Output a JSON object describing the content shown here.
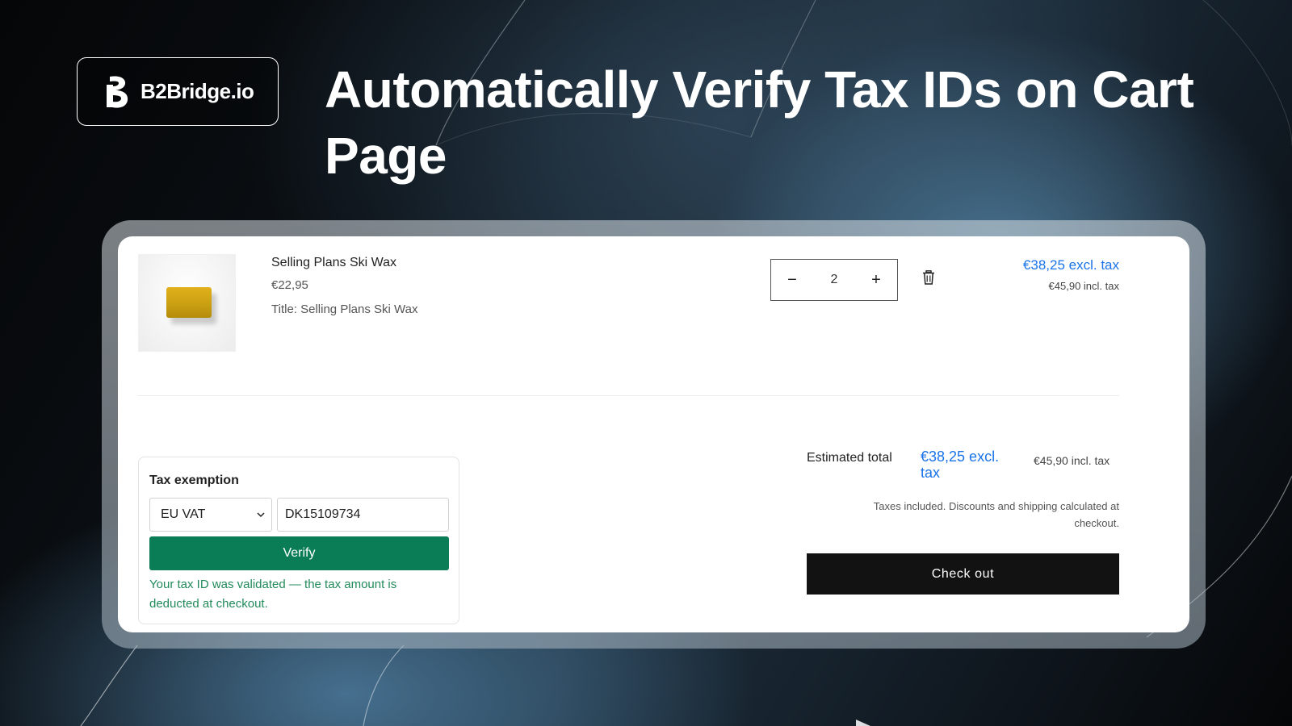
{
  "brand": {
    "name": "B2Bridge.io",
    "logo_icon": "b2bridge-logo-icon"
  },
  "headline": "Automatically Verify Tax IDs on Cart Page",
  "cart_item": {
    "image_icon": "ski-wax-product-image",
    "title": "Selling Plans Ski Wax",
    "unit_price": "€22,95",
    "variant": "Title: Selling Plans Ski Wax",
    "quantity": "2",
    "decrease_symbol": "−",
    "increase_symbol": "+",
    "remove_icon": "trash-icon",
    "price_excl_tax": "€38,25 excl. tax",
    "price_incl_tax": "€45,90 incl. tax"
  },
  "tax_exemption": {
    "title": "Tax exemption",
    "type_selected": "EU VAT",
    "tax_id_value": "DK15109734",
    "verify_label": "Verify",
    "message": "Your tax ID was validated — the tax amount is deducted at checkout."
  },
  "summary": {
    "estimated_label": "Estimated total",
    "estimated_excl": "€38,25 excl. tax",
    "estimated_incl": "€45,90 incl. tax",
    "tax_note": "Taxes included. Discounts and shipping calculated at checkout.",
    "checkout_label": "Check out"
  },
  "colors": {
    "link_blue": "#1a73e8",
    "verify_green": "#0a7d57",
    "success_text": "#218a5a",
    "checkout_black": "#121212"
  }
}
